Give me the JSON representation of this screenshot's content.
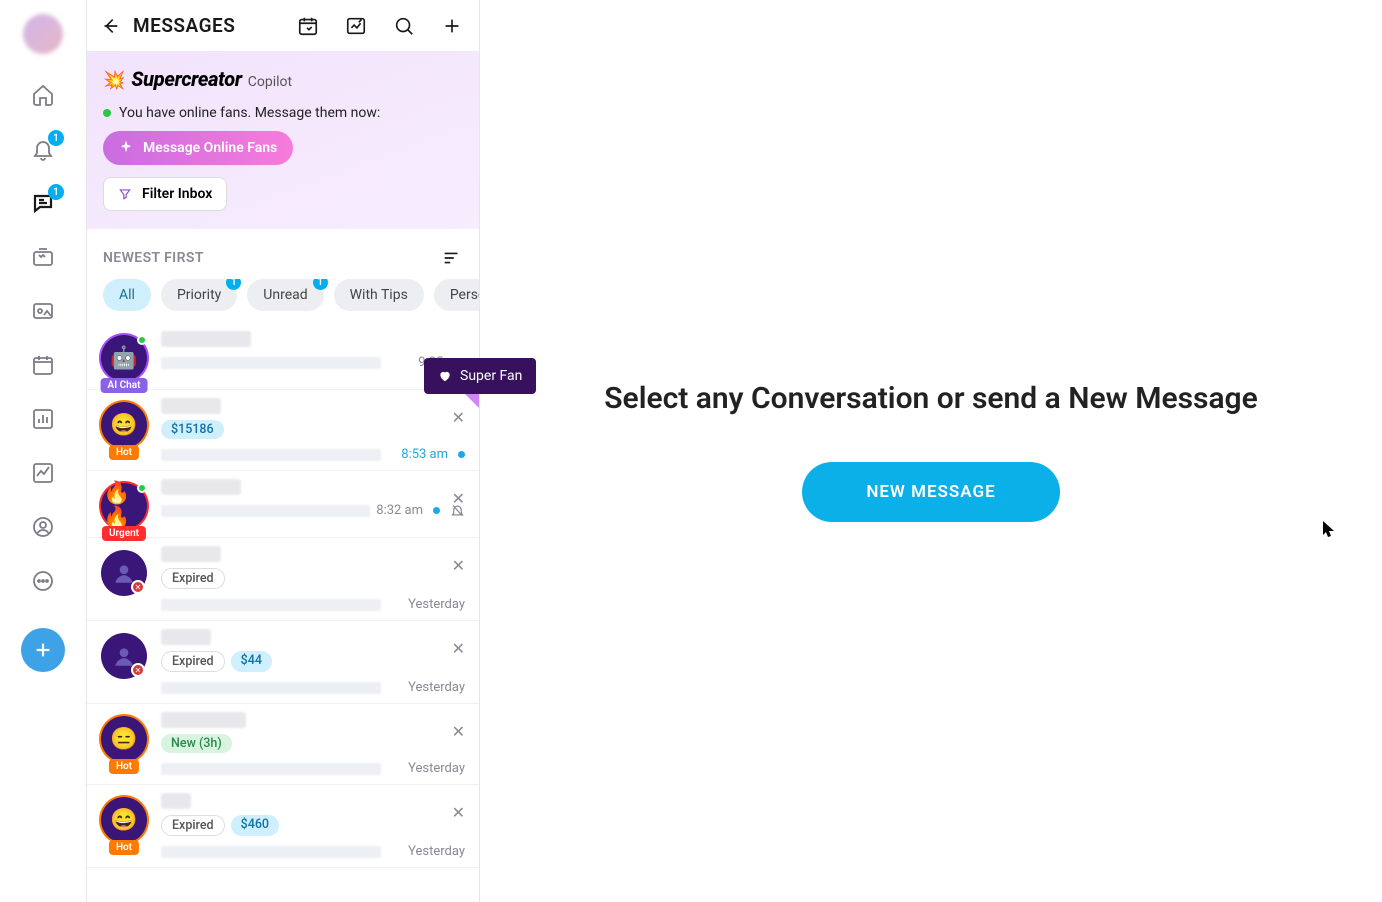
{
  "rail": {
    "notif_badge": "1",
    "chat_badge": "1"
  },
  "header": {
    "title": "MESSAGES"
  },
  "copilot": {
    "brand_name": "Supercreator",
    "brand_sub": "Copilot",
    "online_text": "You have online fans. Message them now:",
    "message_online_label": "Message Online Fans",
    "filter_inbox_label": "Filter Inbox"
  },
  "sort": {
    "label": "NEWEST FIRST"
  },
  "pills": {
    "all": "All",
    "priority": "Priority",
    "priority_badge": "1",
    "unread": "Unread",
    "unread_badge": "1",
    "with_tips": "With Tips",
    "personalized": "Personalized"
  },
  "tooltip": {
    "superfan": "Super Fan"
  },
  "conversations": [
    {
      "avatar_emoji": "🤖",
      "ring": "purple",
      "label": "AI Chat",
      "label_class": "ai",
      "name_w": 90,
      "chips": [],
      "time": "9:05 am",
      "time_blue": false,
      "online": true,
      "corner": false
    },
    {
      "avatar_emoji": "😄",
      "ring": "orange",
      "label": "Hot",
      "label_class": "hot",
      "name_w": 60,
      "chips": [
        {
          "text": "$15186",
          "cls": "chip-money"
        }
      ],
      "time": "8:53 am",
      "time_blue": true,
      "unread": true,
      "corner": true
    },
    {
      "avatar_emoji": "🔥🔥",
      "ring": "red",
      "label": "Urgent",
      "label_class": "urgent",
      "name_w": 80,
      "chips": [],
      "time": "8:32 am",
      "time_blue": false,
      "unread": true,
      "mute": true,
      "online": true
    },
    {
      "avatar_emoji": "",
      "silhouette": true,
      "xbadge": true,
      "name_w": 60,
      "chips": [
        {
          "text": "Expired",
          "cls": "chip-expired"
        }
      ],
      "time": "Yesterday"
    },
    {
      "avatar_emoji": "",
      "silhouette": true,
      "xbadge": true,
      "name_w": 50,
      "chips": [
        {
          "text": "Expired",
          "cls": "chip-expired"
        },
        {
          "text": "$44",
          "cls": "chip-money"
        }
      ],
      "time": "Yesterday"
    },
    {
      "avatar_emoji": "😑",
      "ring": "orange",
      "label": "Hot",
      "label_class": "hot",
      "name_w": 85,
      "chips": [
        {
          "text": "New (3h)",
          "cls": "chip-new"
        }
      ],
      "time": "Yesterday"
    },
    {
      "avatar_emoji": "😄",
      "ring": "orange",
      "label": "Hot",
      "label_class": "hot",
      "name_w": 30,
      "chips": [
        {
          "text": "Expired",
          "cls": "chip-expired"
        },
        {
          "text": "$460",
          "cls": "chip-money"
        }
      ],
      "time": "Yesterday"
    }
  ],
  "main": {
    "title": "Select any Conversation or send a New Message",
    "new_message": "NEW MESSAGE"
  }
}
